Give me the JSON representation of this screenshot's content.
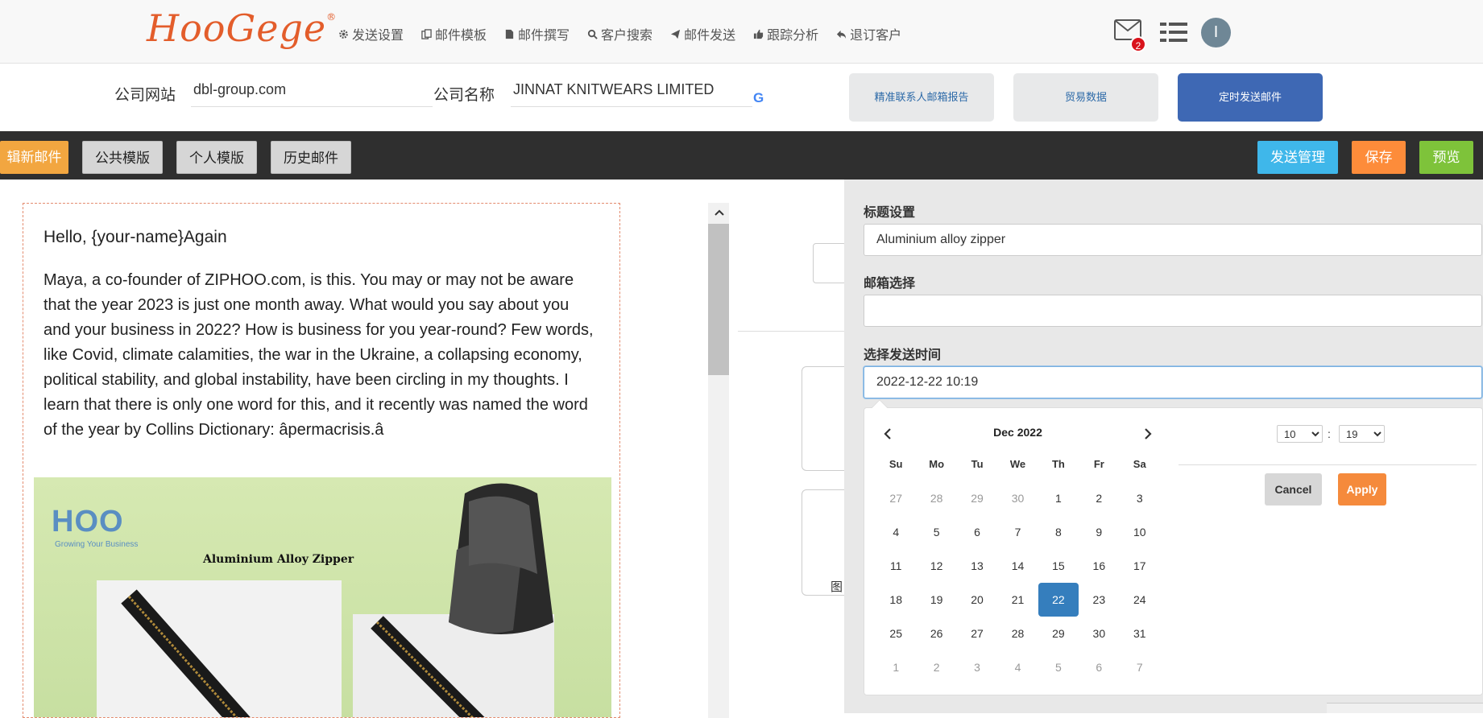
{
  "brand": {
    "name": "HooGege",
    "mark": "®"
  },
  "nav": {
    "items": [
      {
        "label": "发送设置",
        "icon": "gear-icon"
      },
      {
        "label": "邮件模板",
        "icon": "copy-icon"
      },
      {
        "label": "邮件撰写",
        "icon": "file-icon"
      },
      {
        "label": "客户搜索",
        "icon": "search-icon"
      },
      {
        "label": "邮件发送",
        "icon": "paper-plane-icon"
      },
      {
        "label": "跟踪分析",
        "icon": "thumbs-up-icon"
      },
      {
        "label": "退订客户",
        "icon": "reply-icon"
      }
    ],
    "mail_count": "2",
    "avatar_initial": "I"
  },
  "company": {
    "site_label": "公司网站",
    "site_value": "dbl-group.com",
    "name_label": "公司名称",
    "name_value": "JINNAT KNITWEARS LIMITED",
    "google_icon": "G",
    "btn_report": "精准联系人邮箱报告",
    "btn_trade": "贸易数据",
    "btn_schedule": "定时发送邮件"
  },
  "toolbar": {
    "new_mail": "辑新邮件",
    "public_tpl": "公共模版",
    "personal_tpl": "个人模版",
    "history": "历史邮件",
    "send_manage": "发送管理",
    "save": "保存",
    "preview": "预览"
  },
  "editor": {
    "greeting": "Hello, {your-name}Again",
    "body": "Maya, a co-founder of ZIPHOO.com, is this. You may or may not be aware that the year 2023 is just one month away. What would you say about you and your business in 2022? How is business for you year-round? Few words, like Covid, climate calamities, the war in the Ukraine, a collapsing economy, political stability, and global instability, have been circling in my thoughts. I learn that there is only one word for this, and it recently was named the word of the year by Collins Dictionary: âpermacrisis.â",
    "image": {
      "brand": "HOO",
      "tagline": "Growing Your Business",
      "title": "Aluminium Alloy Zipper"
    }
  },
  "side_ghost": {
    "label": "图"
  },
  "panel": {
    "subject_label": "标题设置",
    "subject_value": "Aluminium alloy zipper",
    "mailbox_label": "邮箱选择",
    "mailbox_value": "",
    "time_label": "选择发送时间",
    "time_value": "2022-12-22 10:19"
  },
  "datepicker": {
    "month": "Dec 2022",
    "dow": [
      "Su",
      "Mo",
      "Tu",
      "We",
      "Th",
      "Fr",
      "Sa"
    ],
    "weeks": [
      [
        {
          "d": "27",
          "off": true
        },
        {
          "d": "28",
          "off": true
        },
        {
          "d": "29",
          "off": true
        },
        {
          "d": "30",
          "off": true
        },
        {
          "d": "1"
        },
        {
          "d": "2"
        },
        {
          "d": "3"
        }
      ],
      [
        {
          "d": "4"
        },
        {
          "d": "5"
        },
        {
          "d": "6"
        },
        {
          "d": "7"
        },
        {
          "d": "8"
        },
        {
          "d": "9"
        },
        {
          "d": "10"
        }
      ],
      [
        {
          "d": "11"
        },
        {
          "d": "12"
        },
        {
          "d": "13"
        },
        {
          "d": "14"
        },
        {
          "d": "15"
        },
        {
          "d": "16"
        },
        {
          "d": "17"
        }
      ],
      [
        {
          "d": "18"
        },
        {
          "d": "19"
        },
        {
          "d": "20"
        },
        {
          "d": "21"
        },
        {
          "d": "22",
          "sel": true
        },
        {
          "d": "23"
        },
        {
          "d": "24"
        }
      ],
      [
        {
          "d": "25"
        },
        {
          "d": "26"
        },
        {
          "d": "27"
        },
        {
          "d": "28"
        },
        {
          "d": "29"
        },
        {
          "d": "30"
        },
        {
          "d": "31"
        }
      ],
      [
        {
          "d": "1",
          "off": true
        },
        {
          "d": "2",
          "off": true
        },
        {
          "d": "3",
          "off": true
        },
        {
          "d": "4",
          "off": true
        },
        {
          "d": "5",
          "off": true
        },
        {
          "d": "6",
          "off": true
        },
        {
          "d": "7",
          "off": true
        }
      ]
    ],
    "hour": "10",
    "minute": "19",
    "colon": ":",
    "cancel": "Cancel",
    "apply": "Apply",
    "selected_color": "#357ebd"
  }
}
